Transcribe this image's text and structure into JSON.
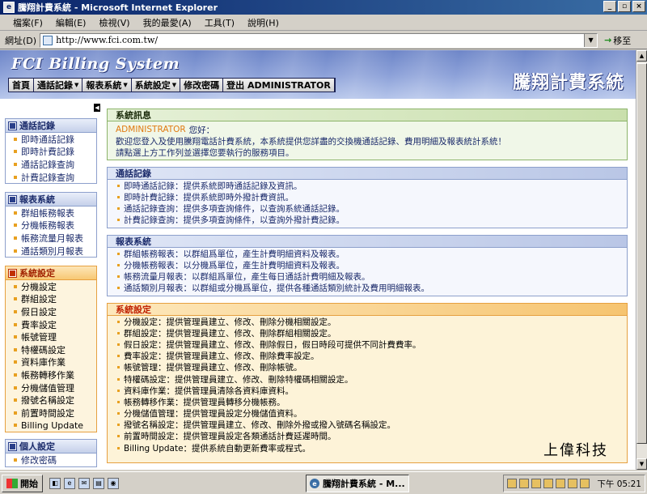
{
  "window": {
    "title": "騰翔計費系統 - Microsoft Internet Explorer",
    "minimize": "_",
    "maximize": "▫",
    "close": "×"
  },
  "menu": [
    "檔案(F)",
    "編輯(E)",
    "檢視(V)",
    "我的最愛(A)",
    "工具(T)",
    "說明(H)"
  ],
  "address": {
    "label": "網址(D)",
    "url": "http://www.fci.com.tw/",
    "go_label": "移至"
  },
  "banner": {
    "brand": "FCI Billing System",
    "cn_title": "騰翔計費系統"
  },
  "nav": [
    {
      "label": "首頁",
      "has_menu": false
    },
    {
      "label": "通話記錄",
      "has_menu": true
    },
    {
      "label": "報表系統",
      "has_menu": true
    },
    {
      "label": "系統設定",
      "has_menu": true
    },
    {
      "label": "修改密碼",
      "has_menu": false
    },
    {
      "label": "登出 ADMINISTRATOR",
      "has_menu": false
    }
  ],
  "sidebar": {
    "call_records": {
      "title": "通話記錄",
      "items": [
        "即時通話記錄",
        "即時計費記錄",
        "通話記錄查詢",
        "計費記錄查詢"
      ]
    },
    "reports": {
      "title": "報表系統",
      "items": [
        "群組帳務報表",
        "分機帳務報表",
        "帳務流量月報表",
        "通話類別月報表"
      ]
    },
    "settings": {
      "title": "系統設定",
      "items": [
        "分機設定",
        "群組設定",
        "假日設定",
        "費率設定",
        "帳號管理",
        "特權碼設定",
        "資料庫作業",
        "帳務轉移作業",
        "分機儲值管理",
        "撥號名稱設定",
        "前置時間設定",
        "Billing Update"
      ]
    },
    "personal": {
      "title": "個人設定",
      "items": [
        "修改密碼"
      ]
    }
  },
  "panels": {
    "system_message": {
      "title": "系統訊息",
      "user": "ADMINISTRATOR",
      "greeting": "您好：",
      "line1": "歡迎您登入及使用騰翔電話計費系統，本系統提供您詳盡的交換機通話記錄、費用明細及報表統計系統！",
      "line2": "請點選上方工作列並選擇您要執行的服務項目。"
    },
    "call_records": {
      "title": "通話記錄",
      "lines": [
        "即時通話記錄：提供系統即時通話記錄及資訊。",
        "即時計費記錄：提供系統即時外撥計費資訊。",
        "通話記錄查詢：提供多項查詢條件，以查詢系統通話記錄。",
        "計費記錄查詢：提供多項查詢條件，以查詢外撥計費記錄。"
      ]
    },
    "reports": {
      "title": "報表系統",
      "lines": [
        "群組帳務報表：以群組爲單位，產生計費明細資料及報表。",
        "分機帳務報表：以分機爲單位，產生計費明細資料及報表。",
        "帳務流量月報表：以群組爲單位，產生每日通話計費明細及報表。",
        "通話類別月報表：以群組或分機爲單位，提供各種通話類別統計及費用明細報表。"
      ]
    },
    "settings": {
      "title": "系統設定",
      "lines": [
        "分機設定：提供管理員建立、修改、刪除分機相關設定。",
        "群組設定：提供管理員建立、修改、刪除群組相關設定。",
        "假日設定：提供管理員建立、修改、刪除假日，假日時段可提供不同計費費率。",
        "費率設定：提供管理員建立、修改、刪除費率設定。",
        "帳號管理：提供管理員建立、修改、刪除帳號。",
        "特權碼設定：提供管理員建立、修改、刪除特權碼相關設定。",
        "資料庫作業：提供管理員清除各資料庫資料。",
        "帳務轉移作業：提供管理員轉移分機帳務。",
        "分機儲值管理：提供管理員設定分機儲值資料。",
        "撥號名稱設定：提供管理員建立、修改、刪除外撥或撥入號碼名稱設定。",
        "前置時間設定：提供管理員設定各類通話計費延遲時間。",
        "Billing Update：提供系統自動更新費率或程式。"
      ]
    }
  },
  "watermark": "上偉科技",
  "taskbar": {
    "start": "開始",
    "task": "騰翔計費系統 - M...",
    "clock": "下午 05:21"
  },
  "colors": {
    "banner": "#7d93d0",
    "sidebar_blue": "#1a2a6a",
    "accent_orange": "#e6a040",
    "user_orange": "#e07a10"
  }
}
